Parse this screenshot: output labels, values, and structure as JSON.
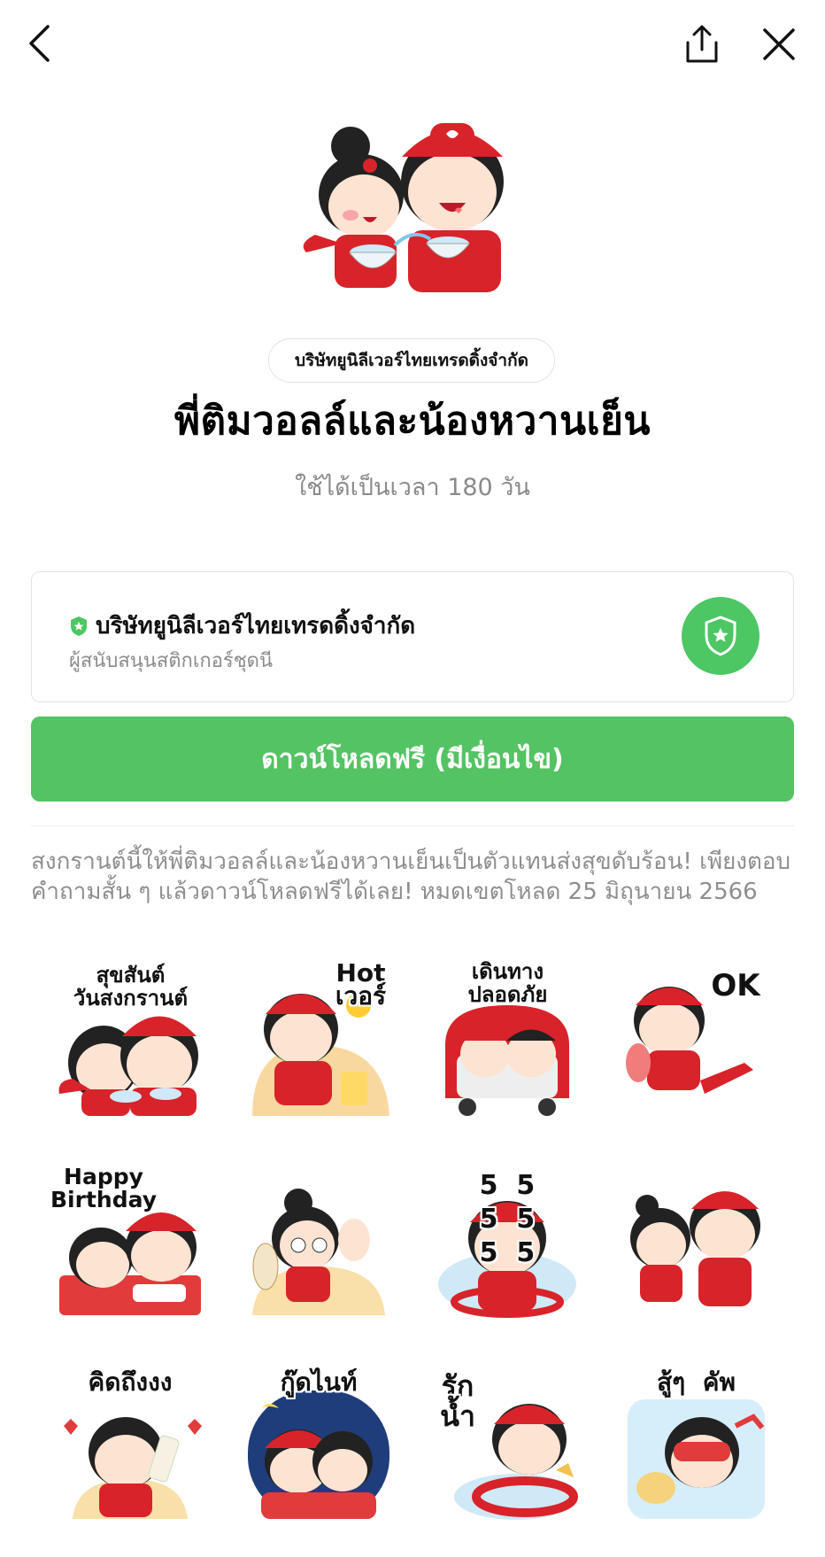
{
  "header": {
    "back_icon": "chevron-left-icon",
    "share_icon": "share-icon",
    "close_icon": "close-icon"
  },
  "product": {
    "author": "บริษัทยูนิลีเวอร์ไทยเทรดดิ้งจำกัด",
    "title": "พี่ติมวอลล์และน้องหวานเย็น",
    "validity": "ใช้ได้เป็นเวลา 180 วัน"
  },
  "sponsor": {
    "name": "บริษัทยูนิลีเวอร์ไทยเทรดดิ้งจำกัด",
    "subtitle": "ผู้สนับสนุนสติกเกอร์ชุดนี",
    "badge_color": "#4cc764"
  },
  "download": {
    "label": "ดาวน์โหลดฟรี (มีเงื่อนไข)",
    "color": "#54c363"
  },
  "description": "สงกรานต์นี้ให้พี่ติมวอลล์และน้องหวานเย็นเป็นตัวแทนส่งสุขดับร้อน! เพียงตอบคำถามสั้น ๆ แล้วดาวน์โหลดฟรีได้เลย! หมดเขตโหลด 25 มิถุนายน 2566",
  "stickers": [
    {
      "caption": "สุขสันต์\nวันสงกรานต์"
    },
    {
      "caption": "Hot\nเวอร์"
    },
    {
      "caption": "เดินทาง\nปลอดภัย"
    },
    {
      "caption": "OK"
    },
    {
      "caption": "Happy\nBirthday"
    },
    {
      "caption": ""
    },
    {
      "caption": "5  5\n5  5\n5  5"
    },
    {
      "caption": ""
    },
    {
      "caption": "คิดถึงงง"
    },
    {
      "caption": "กู๊ดไนท์"
    },
    {
      "caption": "รัก\nน้ำ"
    },
    {
      "caption": "สู้ๆ  คัพ"
    }
  ],
  "colors": {
    "brand_red": "#d8232a",
    "green": "#4cc764"
  }
}
